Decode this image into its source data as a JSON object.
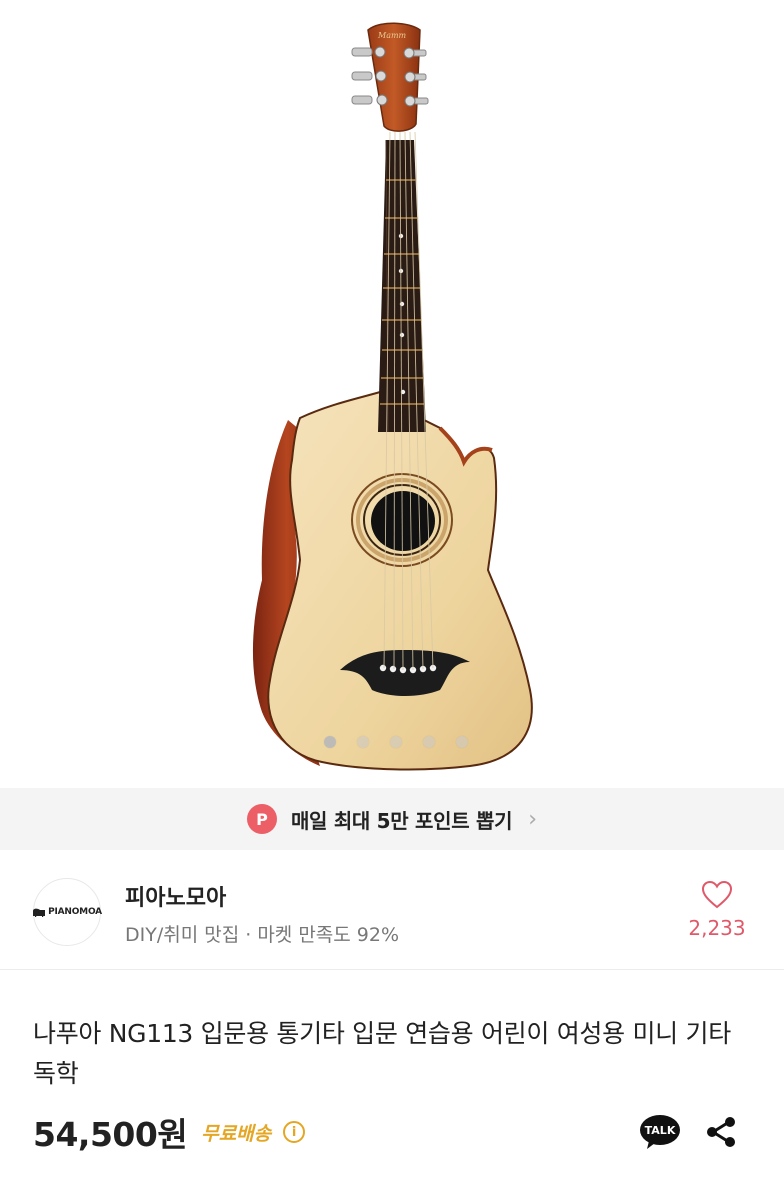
{
  "gallery": {
    "image_alt": "acoustic guitar",
    "slide_count": 5,
    "active_slide": 1
  },
  "promo": {
    "badge": "P",
    "text": "매일 최대 5만 포인트 뽑기",
    "chevron": "›"
  },
  "seller": {
    "logo_text": "PIANOMOA",
    "name": "피아노모아",
    "meta": "DIY/취미 맛집 · 마켓 만족도 92%",
    "like_count": "2,233",
    "like_icon": "heart-outline-icon"
  },
  "product": {
    "title": "나푸아 NG113 입문용 통기타 입문 연습용 어린이 여성용 미니 기타 독학",
    "price": "54,500원",
    "shipping": "무료배송",
    "info_icon": "i",
    "talk_label": "TALK"
  },
  "colors": {
    "accent_red": "#ec5f67",
    "like_red": "#e0596a",
    "shipping_orange": "#e5a623",
    "talk_bg": "#111111"
  }
}
